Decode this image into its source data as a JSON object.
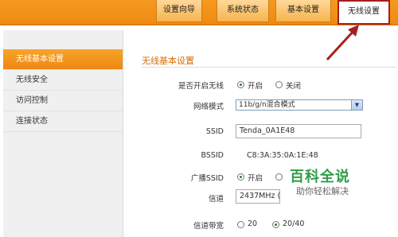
{
  "tabs": [
    {
      "label": "设置向导",
      "active": false
    },
    {
      "label": "系统状态",
      "active": false
    },
    {
      "label": "基本设置",
      "active": false
    },
    {
      "label": "无线设置",
      "active": true
    }
  ],
  "sidebar": {
    "items": [
      {
        "label": "无线基本设置",
        "active": true
      },
      {
        "label": "无线安全",
        "active": false
      },
      {
        "label": "访问控制",
        "active": false
      },
      {
        "label": "连接状态",
        "active": false
      }
    ]
  },
  "section": {
    "title": "无线基本设置"
  },
  "form": {
    "enable_label": "是否开启无线",
    "enable_on": "开启",
    "enable_off": "关闭",
    "mode_label": "网络模式",
    "mode_value": "11b/g/n混合模式",
    "ssid_label": "SSID",
    "ssid_value": "Tenda_0A1E48",
    "bssid_label": "BSSID",
    "bssid_value": "C8:3A:35:0A:1E:48",
    "broadcast_label": "广播SSID",
    "broadcast_on": "开启",
    "channel_label": "信道",
    "channel_value": "2437MHz (Ch",
    "bandwidth_label": "信道带宽",
    "bandwidth_20": "20",
    "bandwidth_2040": "20/40"
  },
  "watermark": {
    "title": "百科全说",
    "subtitle": "助你轻松解决"
  },
  "colors": {
    "accent": "#f08c14",
    "annotation_arrow": "#a61f1f"
  }
}
